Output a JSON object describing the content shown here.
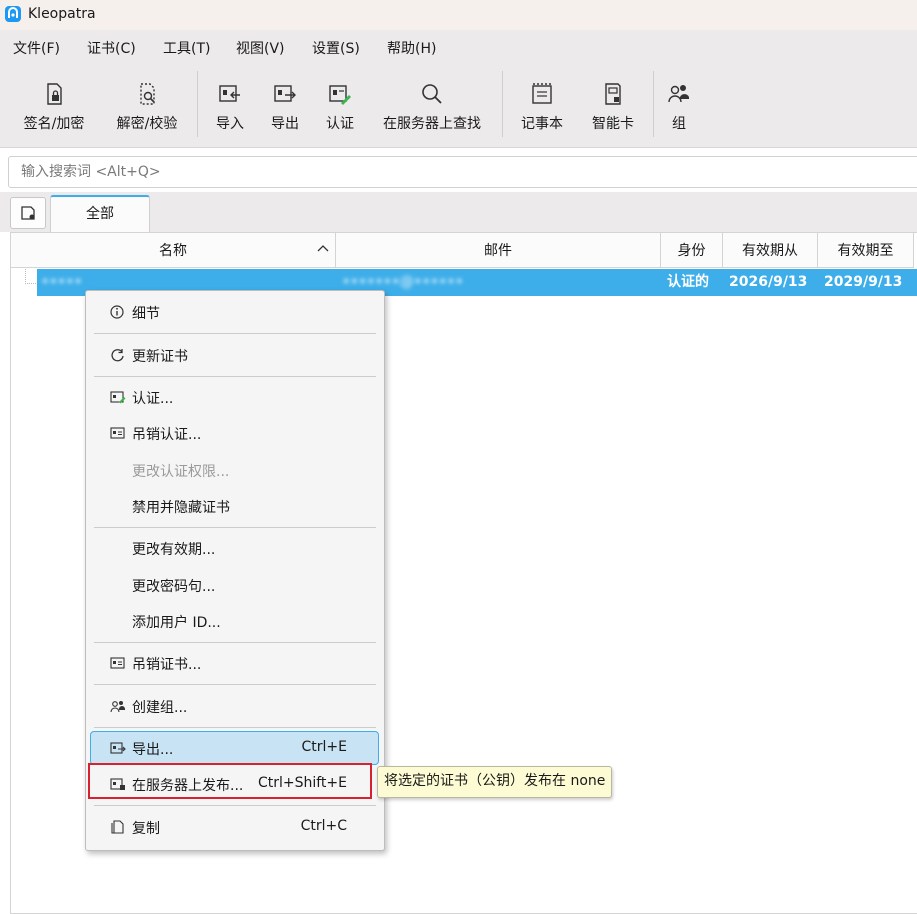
{
  "window": {
    "title": "Kleopatra"
  },
  "menu": [
    "文件(F)",
    "证书(C)",
    "工具(T)",
    "视图(V)",
    "设置(S)",
    "帮助(H)"
  ],
  "toolbar": {
    "sign_encrypt": "签名/加密",
    "decrypt_verify": "解密/校验",
    "import": "导入",
    "export": "导出",
    "certify": "认证",
    "lookup_server": "在服务器上查找",
    "notepad": "记事本",
    "smartcard": "智能卡",
    "groups": "组"
  },
  "search": {
    "placeholder": "输入搜索词 <Alt+Q>"
  },
  "tabs": [
    {
      "label": "全部"
    }
  ],
  "table": {
    "columns": [
      "名称",
      "邮件",
      "身份",
      "有效期从",
      "有效期至"
    ],
    "rows": [
      {
        "name": "•••••",
        "email": "•••••••@••••••",
        "validity": "认证的",
        "valid_from": "2026/9/13",
        "valid_until": "2029/9/13"
      }
    ]
  },
  "context_menu": {
    "details": "细节",
    "update": "更新证书",
    "certify": "认证...",
    "revoke_cert": "吊销认证...",
    "change_trust": "更改认证权限...",
    "disable_hide": "禁用并隐藏证书",
    "change_expiry": "更改有效期...",
    "change_pass": "更改密码句...",
    "add_uid": "添加用户 ID...",
    "revoke": "吊销证书...",
    "create_group": "创建组...",
    "export": "导出...",
    "export_shortcut": "Ctrl+E",
    "publish": "在服务器上发布...",
    "publish_shortcut": "Ctrl+Shift+E",
    "copy": "复制",
    "copy_shortcut": "Ctrl+C"
  },
  "tooltip": "将选定的证书（公钥）发布在 none",
  "colors": {
    "accent": "#3daee9",
    "highlight_box": "#d8202e",
    "tooltip_bg": "#fdfbd3"
  }
}
